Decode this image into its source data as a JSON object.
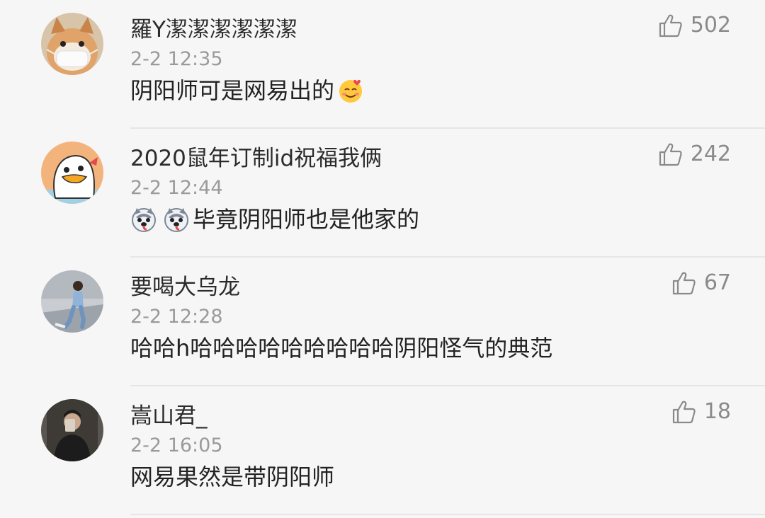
{
  "comments": [
    {
      "username": "羅Y潔潔潔潔潔潔",
      "timestamp": "2-2 12:35",
      "content": "阴阳师可是网易出的",
      "content_suffix_emoji": "smiling-face-hearts-icon",
      "likes": "502",
      "avatar": "shiba-dog-mask-avatar"
    },
    {
      "username": "2020鼠年订制id祝福我俩",
      "timestamp": "2-2 12:44",
      "content_prefix_emojis": [
        "husky-face-icon",
        "husky-face-icon"
      ],
      "content": "毕竟阴阳师也是他家的",
      "likes": "242",
      "avatar": "cartoon-duck-avatar"
    },
    {
      "username": "要喝大乌龙",
      "timestamp": "2-2 12:28",
      "content": "哈哈h哈哈哈哈哈哈哈哈哈阴阳怪气的典范",
      "likes": "67",
      "avatar": "girl-photo-avatar"
    },
    {
      "username": "嵩山君_",
      "timestamp": "2-2 16:05",
      "content": "网易果然是带阴阳师",
      "likes": "18",
      "avatar": "mirror-selfie-avatar"
    }
  ],
  "colors": {
    "background": "#f6f6f6",
    "username": "#2b2b2b",
    "timestamp": "#9a9a9a",
    "content": "#222222",
    "like": "#8a8a8a",
    "divider": "#e6e6e6"
  }
}
